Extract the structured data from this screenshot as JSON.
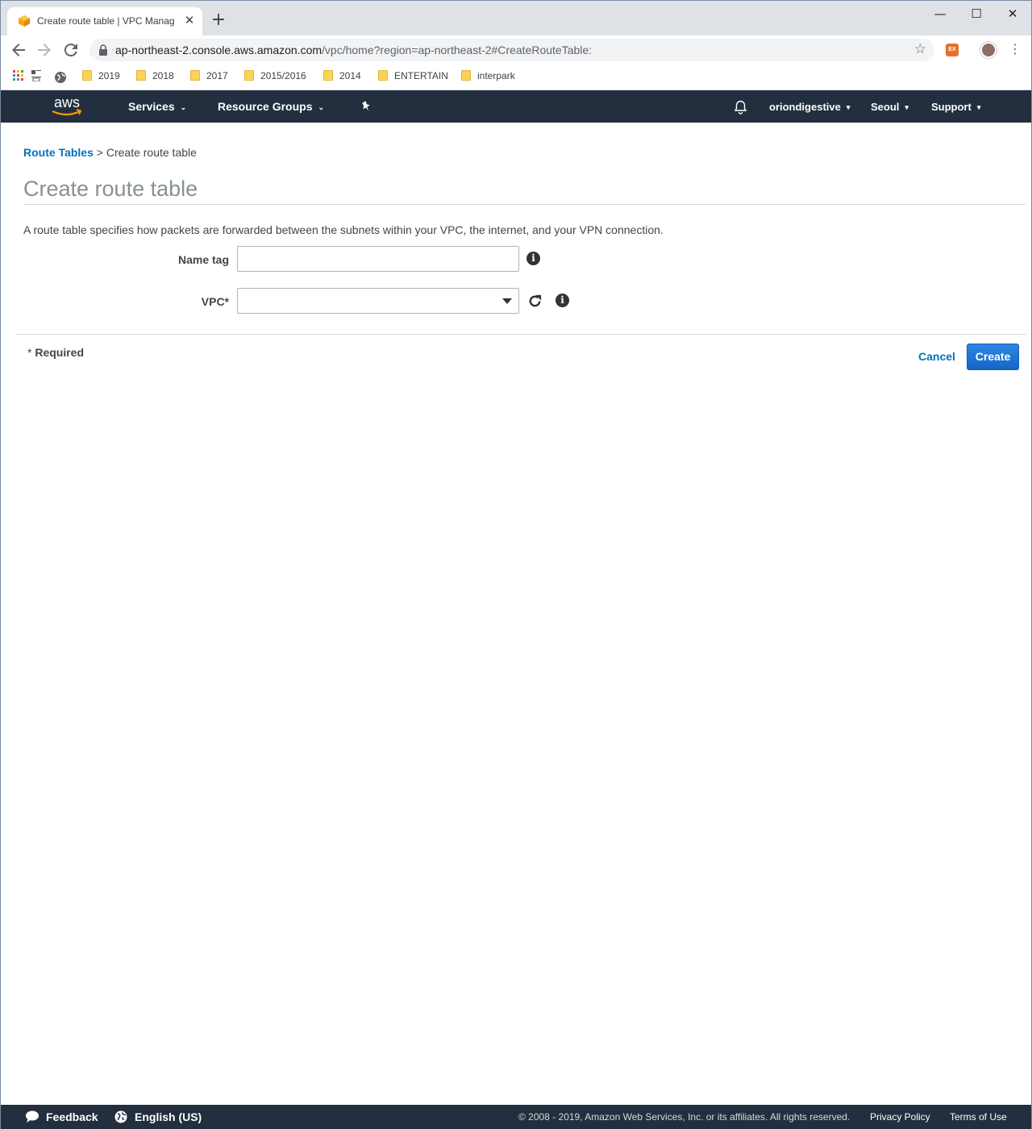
{
  "browser": {
    "tab_title": "Create route table | VPC Manag",
    "tab_close": "✕",
    "new_tab": "+",
    "url_host": "ap-northeast-2.console.aws.amazon.com",
    "url_path": "/vpc/home?region=ap-northeast-2#CreateRouteTable:",
    "extension_label": "EX",
    "window_controls": {
      "minimize": "—",
      "maximize": "☐",
      "close": "✕"
    },
    "bookmarks": [
      {
        "label": "2019"
      },
      {
        "label": "2018"
      },
      {
        "label": "2017"
      },
      {
        "label": "2015/2016"
      },
      {
        "label": "2014"
      },
      {
        "label": "ENTERTAIN"
      },
      {
        "label": "interpark"
      }
    ]
  },
  "aws_nav": {
    "logo_text": "aws",
    "services": "Services",
    "resource_groups": "Resource Groups",
    "account": "oriondigestive",
    "region": "Seoul",
    "support": "Support"
  },
  "content": {
    "breadcrumb_link": "Route Tables",
    "breadcrumb_separator": ">",
    "breadcrumb_current": "Create route table",
    "title": "Create route table",
    "description": "A route table specifies how packets are forwarded between the subnets within your VPC, the internet, and your VPN connection.",
    "name_tag_label": "Name tag",
    "name_tag_value": "",
    "vpc_label": "VPC*",
    "vpc_selected": "",
    "info_glyph": "i",
    "required_asterisk": "*",
    "required_text": "Required",
    "cancel_label": "Cancel",
    "create_label": "Create"
  },
  "footer": {
    "feedback": "Feedback",
    "language": "English (US)",
    "copyright": "© 2008 - 2019, Amazon Web Services, Inc. or its affiliates. All rights reserved.",
    "privacy": "Privacy Policy",
    "terms": "Terms of Use"
  },
  "colors": {
    "aws_nav_bg": "#232f3e",
    "link_blue": "#0073bb",
    "primary_button": "#1a73d9",
    "aws_orange": "#ff9900"
  }
}
